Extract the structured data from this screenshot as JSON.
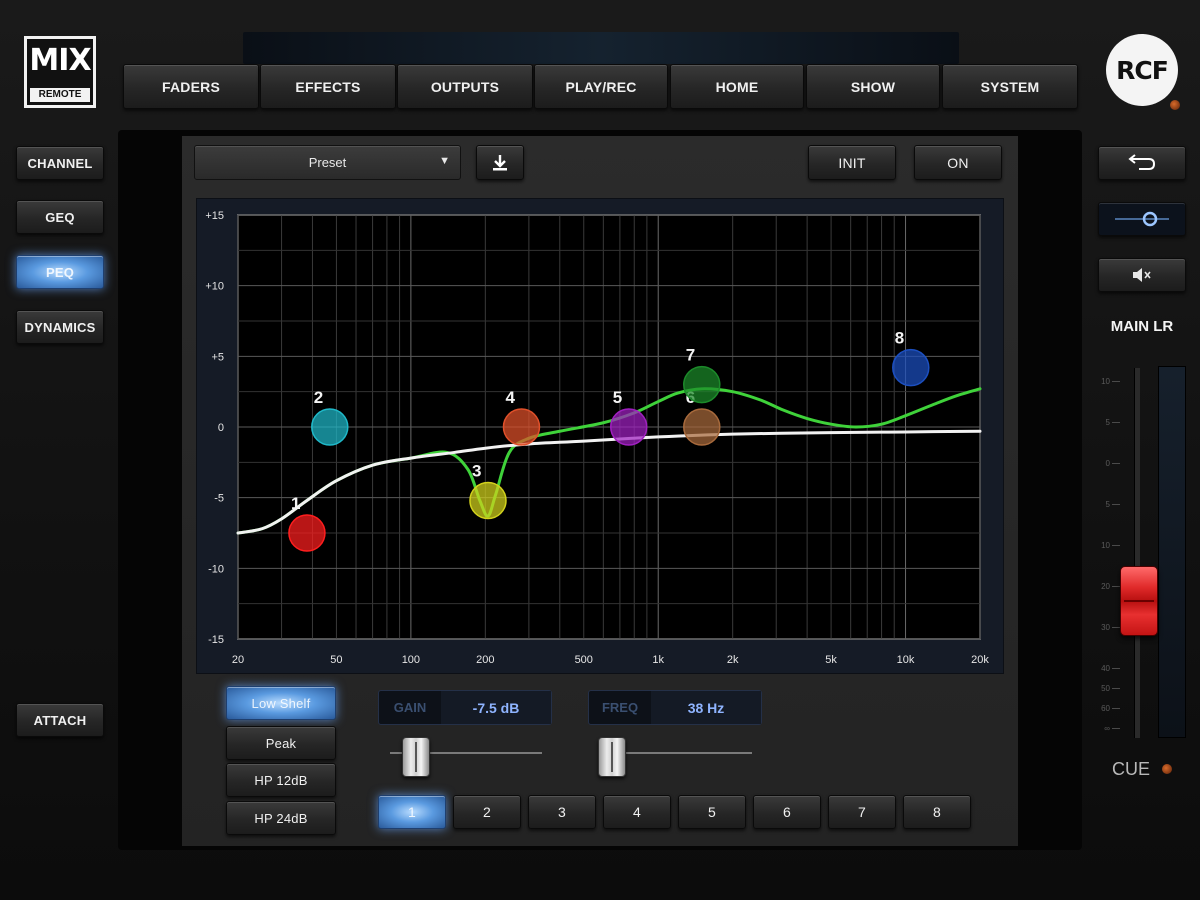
{
  "brand": {
    "logo_main": "MIX",
    "logo_sub": "REMOTE",
    "vendor": "RCF"
  },
  "top_nav": [
    {
      "label": "FADERS"
    },
    {
      "label": "EFFECTS"
    },
    {
      "label": "OUTPUTS"
    },
    {
      "label": "PLAY/REC"
    },
    {
      "label": "HOME"
    },
    {
      "label": "SHOW"
    },
    {
      "label": "SYSTEM"
    }
  ],
  "left_nav": {
    "channel": "CHANNEL",
    "geq": "GEQ",
    "peq": "PEQ",
    "dynamics": "DYNAMICS",
    "attach": "ATTACH",
    "active": "PEQ"
  },
  "toolbar": {
    "preset": "Preset",
    "init": "INIT",
    "on": "ON"
  },
  "right_panel": {
    "channel_name": "MAIN LR",
    "cue": "CUE"
  },
  "filter_types": [
    {
      "label": "Low Shelf",
      "active": true
    },
    {
      "label": "Peak",
      "active": false
    },
    {
      "label": "HP 12dB",
      "active": false
    },
    {
      "label": "HP 24dB",
      "active": false
    }
  ],
  "gain": {
    "label": "GAIN",
    "value": "-7.5 dB"
  },
  "freq": {
    "label": "FREQ",
    "value": "38 Hz"
  },
  "bands": [
    {
      "label": "1",
      "active": true
    },
    {
      "label": "2",
      "active": false
    },
    {
      "label": "3",
      "active": false
    },
    {
      "label": "4",
      "active": false
    },
    {
      "label": "5",
      "active": false
    },
    {
      "label": "6",
      "active": false
    },
    {
      "label": "7",
      "active": false
    },
    {
      "label": "8",
      "active": false
    }
  ],
  "fader_scale": [
    "10",
    "5",
    "0",
    "5",
    "10",
    "20",
    "30",
    "40",
    "50",
    "60",
    "∞"
  ],
  "chart_data": {
    "type": "line",
    "x_scale": "log",
    "xlim": [
      20,
      20000
    ],
    "ylim": [
      -15,
      15
    ],
    "x_ticks": [
      {
        "value": 20,
        "label": "20"
      },
      {
        "value": 50,
        "label": "50"
      },
      {
        "value": 100,
        "label": "100"
      },
      {
        "value": 200,
        "label": "200"
      },
      {
        "value": 500,
        "label": "500"
      },
      {
        "value": 1000,
        "label": "1k"
      },
      {
        "value": 2000,
        "label": "2k"
      },
      {
        "value": 5000,
        "label": "5k"
      },
      {
        "value": 10000,
        "label": "10k"
      },
      {
        "value": 20000,
        "label": "20k"
      }
    ],
    "y_ticks": [
      {
        "value": 15,
        "label": "+15"
      },
      {
        "value": 10,
        "label": "+10"
      },
      {
        "value": 5,
        "label": "+5"
      },
      {
        "value": 0,
        "label": "0"
      },
      {
        "value": -5,
        "label": "-5"
      },
      {
        "value": -10,
        "label": "-10"
      },
      {
        "value": -15,
        "label": "-15"
      }
    ],
    "grid": true,
    "series": [
      {
        "color": "#3fd23a",
        "x": [
          20,
          25,
          30,
          38,
          50,
          70,
          100,
          140,
          170,
          190,
          205,
          220,
          250,
          300,
          400,
          600,
          800,
          1000,
          1200,
          1500,
          2000,
          2600,
          3200,
          4000,
          5000,
          6300,
          8000,
          10000,
          13000,
          16000,
          20000
        ],
        "y": [
          -7.5,
          -7.2,
          -6.5,
          -5.2,
          -3.8,
          -2.7,
          -2.2,
          -1.8,
          -3.0,
          -5.2,
          -6.3,
          -4.8,
          -1.8,
          -0.8,
          -0.3,
          0.3,
          1.0,
          1.8,
          2.4,
          2.7,
          2.5,
          1.9,
          1.2,
          0.6,
          0.2,
          0.0,
          0.2,
          0.8,
          1.6,
          2.2,
          2.7
        ]
      },
      {
        "color": "#f2f2f2",
        "x": [
          20,
          25,
          30,
          38,
          50,
          70,
          100,
          150,
          200,
          300,
          500,
          1000,
          2000,
          5000,
          10000,
          20000
        ],
        "y": [
          -7.5,
          -7.2,
          -6.5,
          -5.2,
          -3.8,
          -2.7,
          -2.2,
          -1.8,
          -1.5,
          -1.2,
          -1.0,
          -0.7,
          -0.5,
          -0.4,
          -0.35,
          -0.3
        ]
      }
    ],
    "points": [
      {
        "label": "1",
        "freq": 38,
        "gain": -7.5,
        "color": "#ff1e1e"
      },
      {
        "label": "2",
        "freq": 47,
        "gain": 0,
        "color": "#1fb9c9"
      },
      {
        "label": "3",
        "freq": 205,
        "gain": -5.2,
        "color": "#d2d21c"
      },
      {
        "label": "4",
        "freq": 280,
        "gain": 0,
        "color": "#e0502a"
      },
      {
        "label": "5",
        "freq": 760,
        "gain": 0,
        "color": "#a020c0"
      },
      {
        "label": "6",
        "freq": 1500,
        "gain": 0,
        "color": "#a86a3c"
      },
      {
        "label": "7",
        "freq": 1500,
        "gain": 3.0,
        "color": "#1c8a2a"
      },
      {
        "label": "8",
        "freq": 10500,
        "gain": 4.2,
        "color": "#1c4fc0"
      }
    ]
  }
}
